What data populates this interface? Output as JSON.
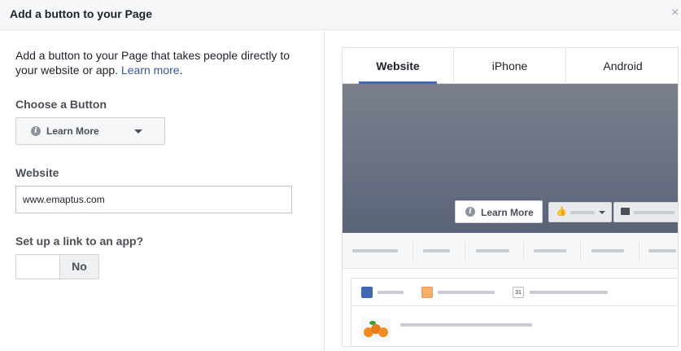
{
  "dialog": {
    "title": "Add a button to your Page",
    "close_glyph": "×"
  },
  "left": {
    "intro_text": "Add a button to your Page that takes people directly to your website or app.",
    "intro_link": "Learn more",
    "intro_suffix": ".",
    "choose_label": "Choose a Button",
    "selected_button": "Learn More",
    "website_label": "Website",
    "website_value": "www.emaptus.com",
    "app_link_label": "Set up a link to an app?",
    "toggle_state": "No"
  },
  "preview": {
    "tabs": [
      {
        "label": "Website",
        "active": true
      },
      {
        "label": "iPhone",
        "active": false
      },
      {
        "label": "Android",
        "active": false
      }
    ],
    "cover_button_label": "Learn More",
    "calendar_day": "31"
  },
  "colors": {
    "link": "#365899",
    "accent": "#4267b2",
    "cover": "#6a7183"
  },
  "icons": {
    "close": "close-icon",
    "info": "info-icon",
    "caret": "chevron-down-icon",
    "like": "thumbs-up-icon",
    "message": "chat-bubble-icon",
    "compose": "pencil-icon",
    "photo": "photo-icon",
    "event": "calendar-icon"
  }
}
